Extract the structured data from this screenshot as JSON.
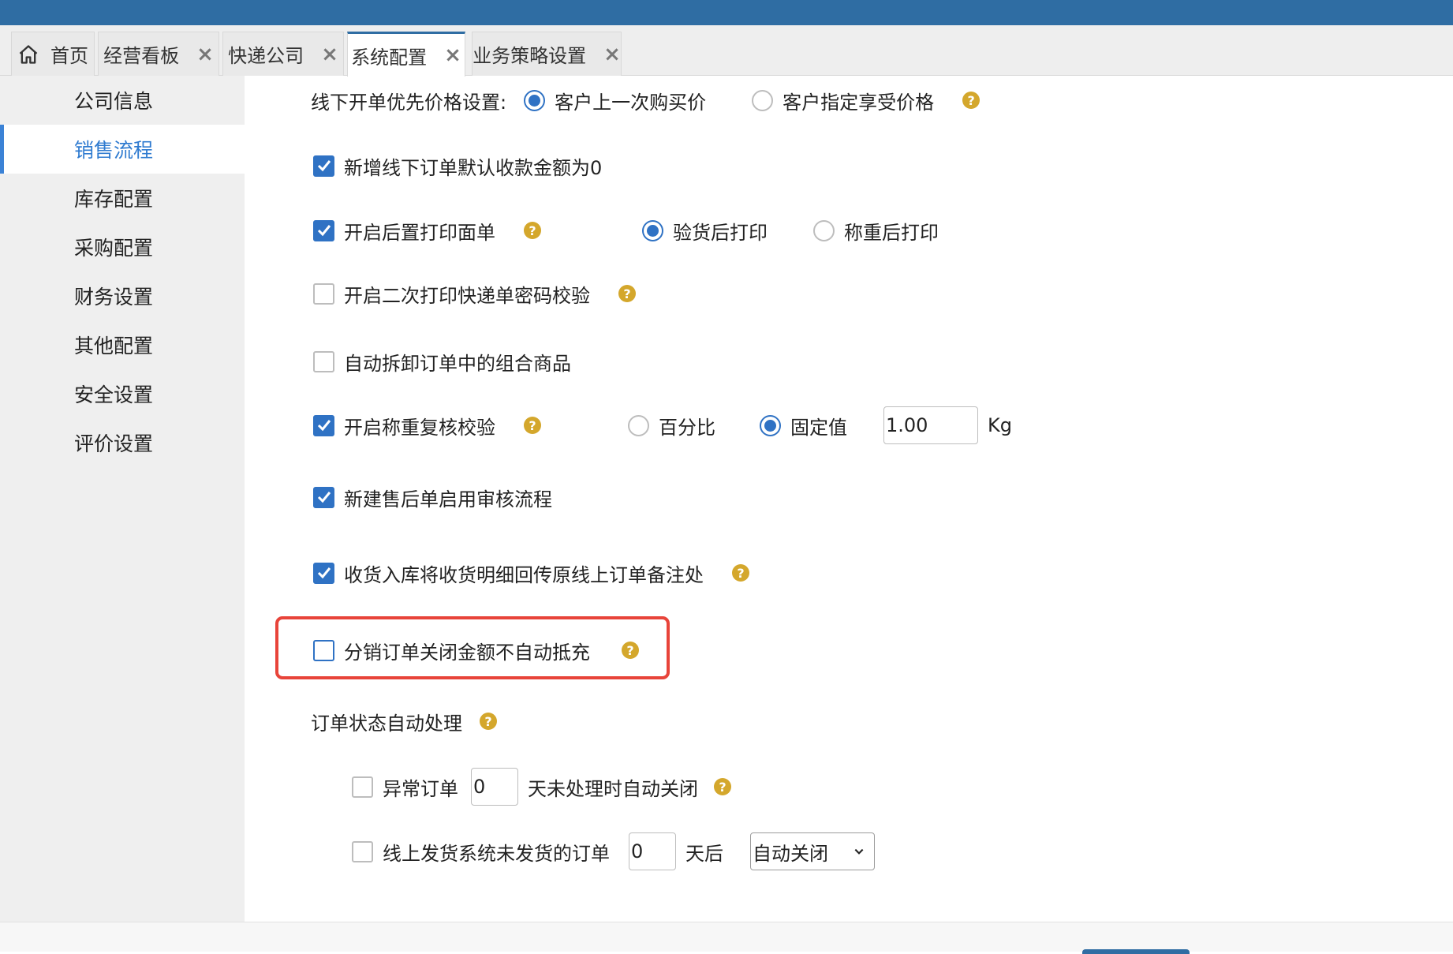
{
  "tabs": [
    {
      "label": "首页",
      "icon": "home-icon",
      "closable": false
    },
    {
      "label": "经营看板",
      "close": "×"
    },
    {
      "label": "快递公司",
      "close": "×"
    },
    {
      "label": "系统配置",
      "close": "×",
      "active": true
    },
    {
      "label": "业务策略设置",
      "close": "×"
    }
  ],
  "sidebar": {
    "items": [
      {
        "label": "公司信息"
      },
      {
        "label": "销售流程",
        "active": true
      },
      {
        "label": "库存配置"
      },
      {
        "label": "采购配置"
      },
      {
        "label": "财务设置"
      },
      {
        "label": "其他配置"
      },
      {
        "label": "安全设置"
      },
      {
        "label": "评价设置"
      }
    ]
  },
  "settings": {
    "offline_price": {
      "label": "线下开单优先价格设置:",
      "options": [
        "客户上一次购买价",
        "客户指定享受价格"
      ],
      "selected": 0
    },
    "default_receipt_zero": {
      "label": "新增线下订单默认收款金额为0",
      "checked": true
    },
    "post_print": {
      "label": "开启后置打印面单",
      "checked": true,
      "options": [
        "验货后打印",
        "称重后打印"
      ],
      "selected": 0
    },
    "second_print_password": {
      "label": "开启二次打印快递单密码校验",
      "checked": false
    },
    "auto_split_combo": {
      "label": "自动拆卸订单中的组合商品",
      "checked": false
    },
    "weight_check": {
      "label": "开启称重复核校验",
      "checked": true,
      "options": [
        "百分比",
        "固定值"
      ],
      "selected": 1,
      "value": "1.00",
      "unit": "Kg"
    },
    "aftersale_review": {
      "label": "新建售后单启用审核流程",
      "checked": true
    },
    "receive_backfill": {
      "label": "收货入库将收货明细回传原线上订单备注处",
      "checked": true
    },
    "distribution_no_offset": {
      "label": "分销订单关闭金额不自动抵充",
      "checked": false
    },
    "auto_process": {
      "title": "订单状态自动处理",
      "abnormal": {
        "label": "异常订单",
        "days": "0",
        "suffix": "天未处理时自动关闭",
        "checked": false
      },
      "online_unshipped": {
        "label": "线上发货系统未发货的订单",
        "days": "0",
        "suffix": "天后",
        "action": "自动关闭",
        "checked": false
      }
    }
  },
  "colors": {
    "header": "#2f6da3",
    "accent": "#2f72c4",
    "help": "#d4a72c",
    "highlight": "#e8443a"
  }
}
